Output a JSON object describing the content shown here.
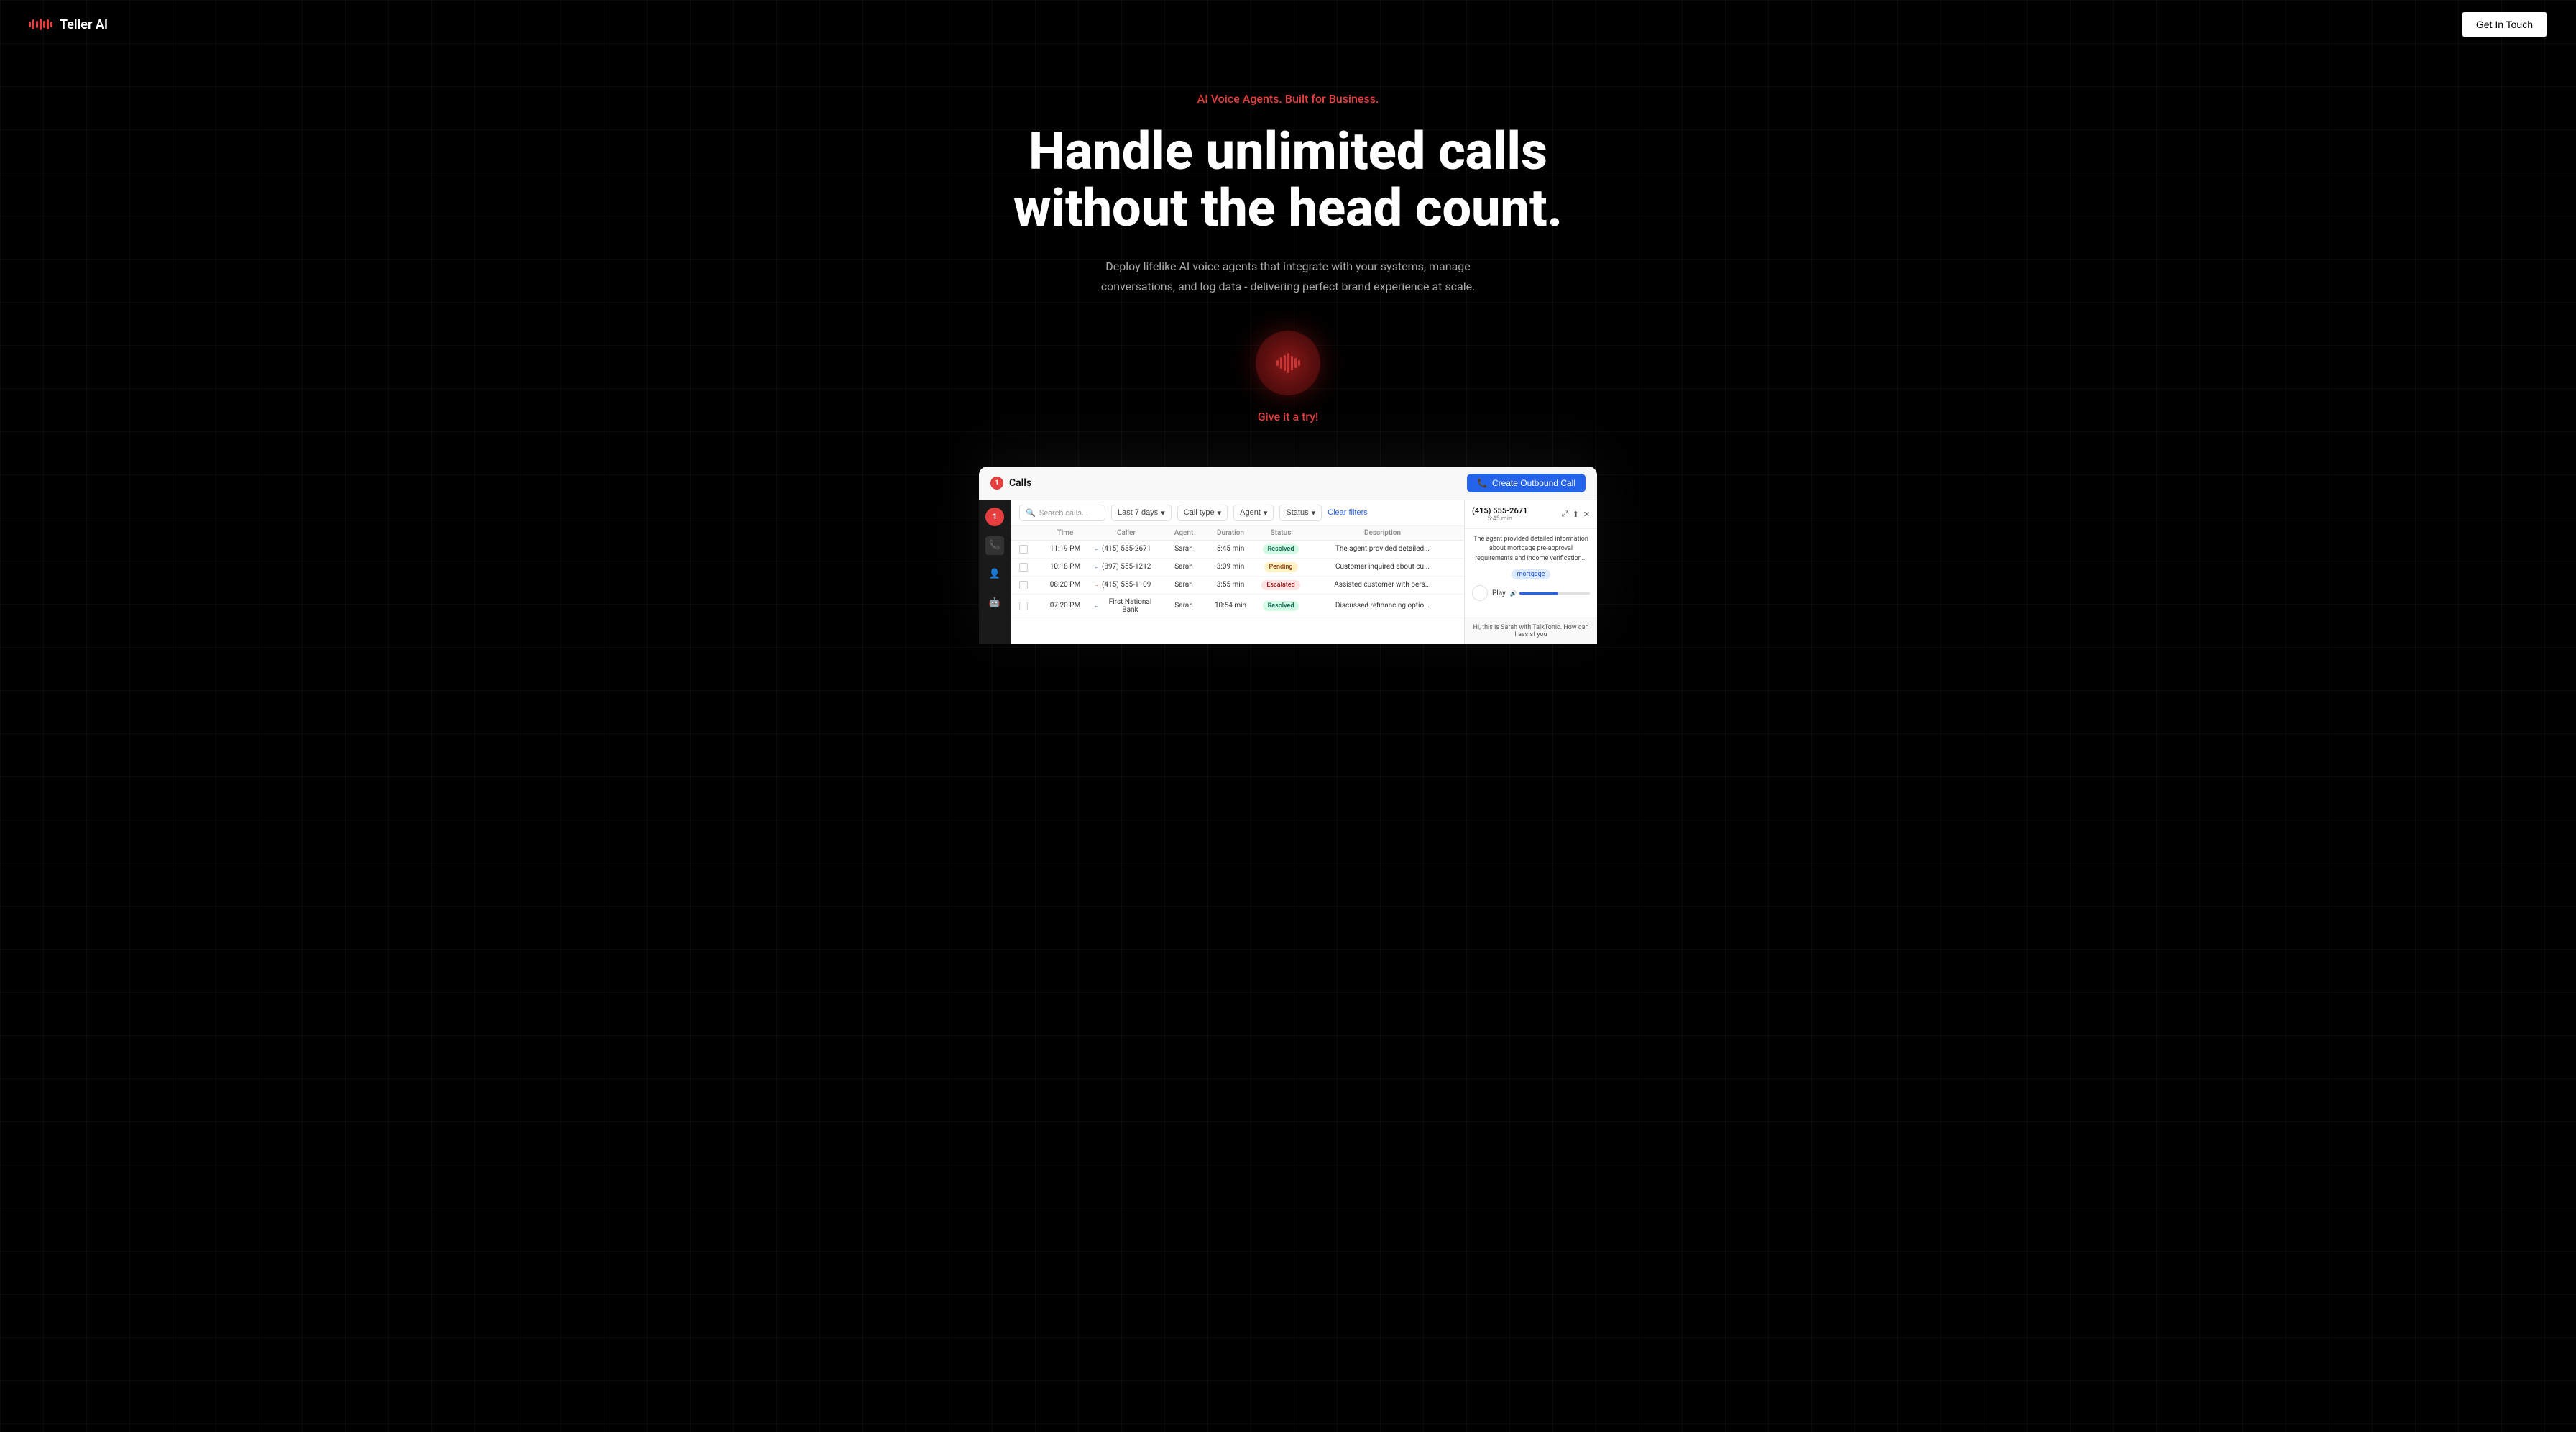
{
  "brand": {
    "name": "Teller AI",
    "logo_alt": "Teller AI logo"
  },
  "navbar": {
    "cta_label": "Get In Touch"
  },
  "hero": {
    "tagline": "AI Voice Agents. Built for Business.",
    "title_line1": "Handle unlimited calls",
    "title_line2": "without the head count.",
    "subtitle": "Deploy lifelike AI voice agents that integrate with your systems, manage conversations, and log data - delivering perfect brand experience at scale.",
    "voice_button_label": "Give it a try!"
  },
  "dashboard": {
    "header": {
      "title": "Calls",
      "badge": "1",
      "create_button_label": "Create Outbound Call"
    },
    "search_placeholder": "Search calls...",
    "filters": {
      "date_range": "Last 7 days",
      "call_type": "Call type",
      "agent": "Agent",
      "status": "Status",
      "clear_label": "Clear filters"
    },
    "table": {
      "headers": [
        "",
        "Time",
        "Caller",
        "Agent",
        "Duration",
        "Status",
        "Description"
      ],
      "rows": [
        {
          "time": "11:19 PM",
          "caller": "(415) 555-2671",
          "caller_type": "inbound",
          "agent": "Sarah",
          "duration": "5:45 min",
          "status": "Resolved",
          "description": "The agent provided detailed..."
        },
        {
          "time": "10:18 PM",
          "caller": "(897) 555-1212",
          "caller_type": "inbound",
          "agent": "Sarah",
          "duration": "3:09 min",
          "status": "Pending",
          "description": "Customer inquired about cu..."
        },
        {
          "time": "08:20 PM",
          "caller": "(415) 555-1109",
          "caller_type": "outbound",
          "agent": "Sarah",
          "duration": "3:55 min",
          "status": "Escalated",
          "description": "Assisted customer with pers..."
        },
        {
          "time": "07:20 PM",
          "caller": "First National Bank",
          "caller_type": "inbound",
          "agent": "Sarah",
          "duration": "10:54 min",
          "status": "Resolved",
          "description": "Discussed refinancing optio..."
        }
      ]
    },
    "detail_panel": {
      "phone": "(415) 555-2671",
      "duration": "5:45 min",
      "description": "The agent provided detailed information about mortgage pre-approval requirements and income verification...",
      "tag": "mortgage",
      "play_label": "Play",
      "chat_text": "Hi, this is Sarah with TalkTonic. How can I assist you"
    }
  }
}
